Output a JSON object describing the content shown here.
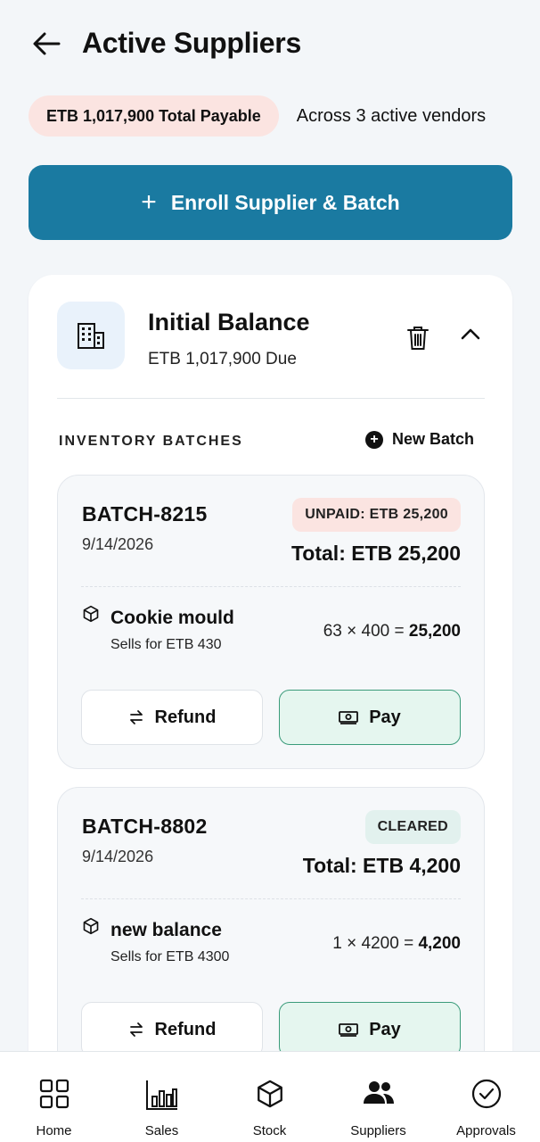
{
  "header": {
    "title": "Active Suppliers",
    "back_icon": "arrow-left-icon"
  },
  "summary": {
    "total_payable": "ETB 1,017,900 Total Payable",
    "vendor_count": "Across 3 active vendors"
  },
  "enroll_button": {
    "label": "Enroll Supplier & Batch",
    "plus": "+"
  },
  "colors": {
    "primary": "#1a7aa1",
    "unpaid_badge": "#fbe4e1",
    "cleared_badge": "#e2f1ee",
    "pay_border": "#3a9b7a",
    "pay_bg": "#e5f6ef"
  },
  "supplier": {
    "name": "Initial Balance",
    "due": "ETB 1,017,900 Due",
    "icon": "building-icon",
    "batches_heading": "INVENTORY BATCHES",
    "new_batch_label": "New Batch",
    "batches": [
      {
        "id": "BATCH-8215",
        "date": "9/14/2026",
        "status": "UNPAID: ETB 25,200",
        "status_kind": "unpaid",
        "total": "Total: ETB 25,200",
        "item_name": "Cookie mould",
        "item_sells": "Sells for ETB 430",
        "calc_expr": "63 × 400 = ",
        "calc_result": "25,200",
        "refund_label": "Refund",
        "pay_label": "Pay"
      },
      {
        "id": "BATCH-8802",
        "date": "9/14/2026",
        "status": "CLEARED",
        "status_kind": "cleared",
        "total": "Total: ETB 4,200",
        "item_name": "new balance",
        "item_sells": "Sells for ETB 4300",
        "calc_expr": "1 × 4200 = ",
        "calc_result": "4,200",
        "refund_label": "Refund",
        "pay_label": "Pay"
      }
    ]
  },
  "nav": [
    {
      "label": "Home",
      "icon": "grid-icon"
    },
    {
      "label": "Sales",
      "icon": "bar-chart-icon"
    },
    {
      "label": "Stock",
      "icon": "box-icon"
    },
    {
      "label": "Suppliers",
      "icon": "users-icon"
    },
    {
      "label": "Approvals",
      "icon": "check-circle-icon"
    }
  ]
}
